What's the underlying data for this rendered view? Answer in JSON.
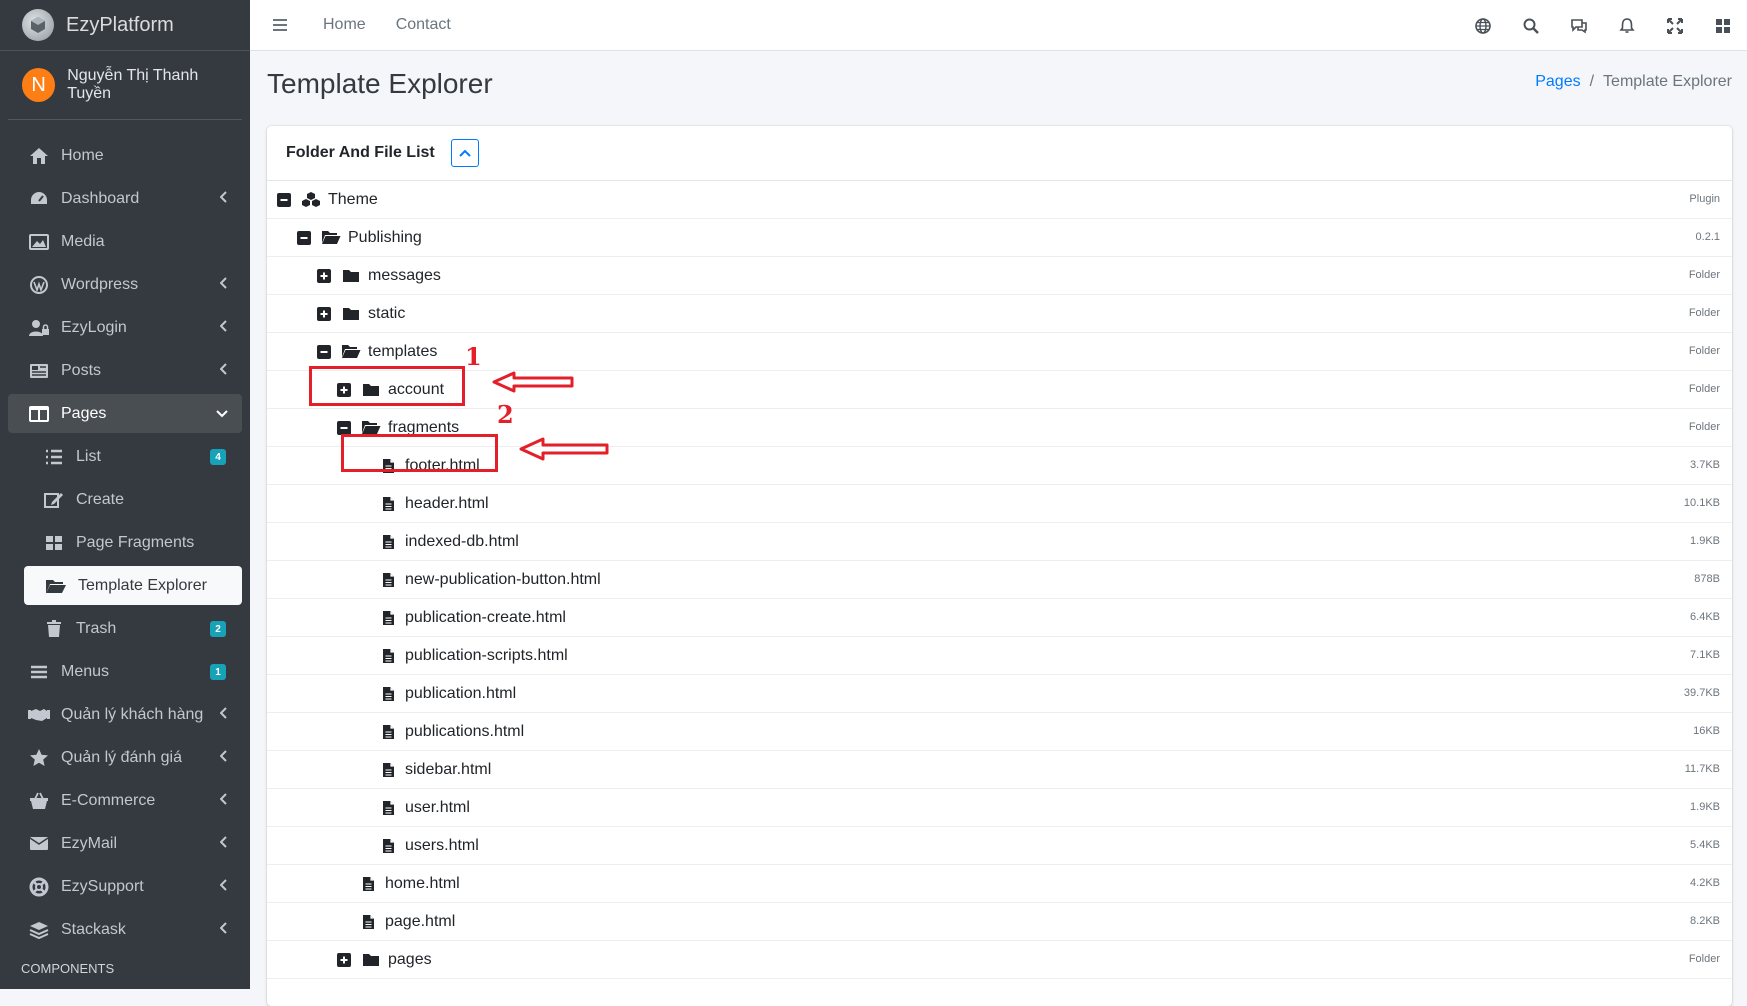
{
  "brand": {
    "name": "EzyPlatform"
  },
  "user": {
    "initial": "N",
    "name": "Nguyễn Thị Thanh Tuyền"
  },
  "sidebar": {
    "items": [
      {
        "label": "Home",
        "icon": "home-icon"
      },
      {
        "label": "Dashboard",
        "icon": "dashboard-icon"
      },
      {
        "label": "Media",
        "icon": "image-icon"
      },
      {
        "label": "Wordpress",
        "icon": "wordpress-icon"
      },
      {
        "label": "EzyLogin",
        "icon": "user-lock-icon"
      },
      {
        "label": "Posts",
        "icon": "newspaper-icon"
      },
      {
        "label": "Pages",
        "icon": "columns-icon"
      }
    ],
    "pages_sub": [
      {
        "label": "List",
        "badge": "4"
      },
      {
        "label": "Create"
      },
      {
        "label": "Page Fragments"
      },
      {
        "label": "Template Explorer"
      },
      {
        "label": "Trash",
        "badge": "2"
      }
    ],
    "items_after": [
      {
        "label": "Menus",
        "badge": "1"
      },
      {
        "label": "Quản lý khách hàng"
      },
      {
        "label": "Quản lý đánh giá"
      },
      {
        "label": "E-Commerce"
      },
      {
        "label": "EzyMail"
      },
      {
        "label": "EzySupport"
      },
      {
        "label": "Stackask"
      }
    ],
    "section_header": "COMPONENTS"
  },
  "topbar": {
    "links": [
      "Home",
      "Contact"
    ]
  },
  "page": {
    "title": "Template Explorer"
  },
  "breadcrumb": {
    "parent": "Pages",
    "current": "Template Explorer"
  },
  "card": {
    "title": "Folder And File List"
  },
  "tree": [
    {
      "name": "Theme",
      "meta": "Plugin"
    },
    {
      "name": "Publishing",
      "meta": "0.2.1"
    },
    {
      "name": "messages",
      "meta": "Folder"
    },
    {
      "name": "static",
      "meta": "Folder"
    },
    {
      "name": "templates",
      "meta": "Folder"
    },
    {
      "name": "account",
      "meta": "Folder"
    },
    {
      "name": "fragments",
      "meta": "Folder"
    },
    {
      "name": "footer.html",
      "meta": "3.7KB"
    },
    {
      "name": "header.html",
      "meta": "10.1KB"
    },
    {
      "name": "indexed-db.html",
      "meta": "1.9KB"
    },
    {
      "name": "new-publication-button.html",
      "meta": "878B"
    },
    {
      "name": "publication-create.html",
      "meta": "6.4KB"
    },
    {
      "name": "publication-scripts.html",
      "meta": "7.1KB"
    },
    {
      "name": "publication.html",
      "meta": "39.7KB"
    },
    {
      "name": "publications.html",
      "meta": "16KB"
    },
    {
      "name": "sidebar.html",
      "meta": "11.7KB"
    },
    {
      "name": "user.html",
      "meta": "1.9KB"
    },
    {
      "name": "users.html",
      "meta": "5.4KB"
    },
    {
      "name": "home.html",
      "meta": "4.2KB"
    },
    {
      "name": "page.html",
      "meta": "8.2KB"
    },
    {
      "name": "pages",
      "meta": "Folder"
    }
  ],
  "annotations": {
    "first": "1",
    "second": "2",
    "color": "#e3202a"
  },
  "colors": {
    "sidebar": "#343a40",
    "link": "#007bff",
    "badge": "#17a2b8",
    "avatar": "#fd7e14"
  }
}
